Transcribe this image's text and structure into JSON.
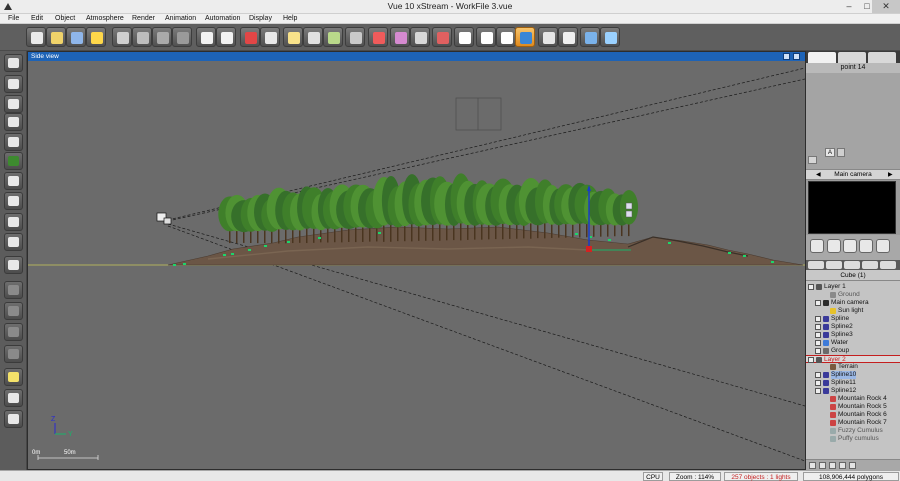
{
  "window": {
    "title": "Vue 10 xStream - WorkFile 3.vue",
    "minimize_label": "–",
    "maximize_label": "□",
    "close_label": "✕"
  },
  "menu": {
    "items": [
      "File",
      "Edit",
      "Object",
      "Atmosphere",
      "Render",
      "Animation",
      "Automation",
      "Display",
      "Help"
    ]
  },
  "toolbar": {
    "icons": [
      "new-file-icon",
      "open-file-icon",
      "save-file-icon",
      "quick-render-icon",
      "cut-icon",
      "copy-icon",
      "paste-icon",
      "duplicate-icon",
      "undo-icon",
      "redo-icon",
      "render-icon",
      "render-area-icon",
      "weather-icon",
      "object-editor-icon",
      "materials-icon",
      "group-icon",
      "color-palette-icon",
      "brush-icon",
      "stats-icon",
      "timeline-icon",
      "magic-icon",
      "zoom-fit-icon",
      "zoom-in-icon",
      "zoom-out-icon",
      "pan-icon",
      "animation-icon",
      "film-icon",
      "layout-icon",
      "world-browser-icon"
    ],
    "active_icon": "pan-icon"
  },
  "left_tools": {
    "icons": [
      "plane-icon",
      "sphere-icon",
      "text-icon",
      "terrain-icon",
      "mountain-icon",
      "plant-icon",
      "rock-icon",
      "cloud-icon",
      "light-icon",
      "spline-icon",
      "cube-icon",
      "boolean-icon",
      "metablob-icon",
      "group-object-icon",
      "ecosystem-icon",
      "sun-icon",
      "wind-icon",
      "external-icon"
    ]
  },
  "viewport": {
    "title": "Side view",
    "axis_z": "Z",
    "axis_y": "Y",
    "scale_start": "0m",
    "scale_end": "50m"
  },
  "right_panel": {
    "point_label": "point 14",
    "a_label": "A",
    "camera_title": "Main camera",
    "object_title": "Cube (1)",
    "tree": [
      {
        "label": "Layer 1",
        "depth": 0,
        "kind": "layer",
        "icon": "layer-icon"
      },
      {
        "label": "Ground",
        "depth": 2,
        "kind": "dim",
        "icon": "ground-icon"
      },
      {
        "label": "Main camera",
        "depth": 1,
        "kind": "item",
        "icon": "camera-icon"
      },
      {
        "label": "Sun light",
        "depth": 2,
        "kind": "item",
        "icon": "sun-icon"
      },
      {
        "label": "Spline",
        "depth": 1,
        "kind": "item",
        "icon": "spline-icon"
      },
      {
        "label": "Spline2",
        "depth": 1,
        "kind": "item",
        "icon": "spline-icon"
      },
      {
        "label": "Spline3",
        "depth": 1,
        "kind": "item",
        "icon": "spline-icon"
      },
      {
        "label": "Water",
        "depth": 1,
        "kind": "item",
        "icon": "water-icon"
      },
      {
        "label": "Group",
        "depth": 1,
        "kind": "item",
        "icon": "group-icon"
      },
      {
        "label": "Layer 2",
        "depth": 0,
        "kind": "layer2",
        "icon": "layer-icon"
      },
      {
        "label": "Terrain",
        "depth": 2,
        "kind": "item",
        "icon": "terrain-icon"
      },
      {
        "label": "Spline10",
        "depth": 1,
        "kind": "sel",
        "icon": "spline-icon"
      },
      {
        "label": "Spline11",
        "depth": 1,
        "kind": "item",
        "icon": "spline-icon"
      },
      {
        "label": "Spline12",
        "depth": 1,
        "kind": "item",
        "icon": "spline-icon"
      },
      {
        "label": "Mountain Rock 4",
        "depth": 2,
        "kind": "item",
        "icon": "rock-icon"
      },
      {
        "label": "Mountain Rock 5",
        "depth": 2,
        "kind": "item",
        "icon": "rock-icon"
      },
      {
        "label": "Mountain Rock 6",
        "depth": 2,
        "kind": "item",
        "icon": "rock-icon"
      },
      {
        "label": "Mountain Rock 7",
        "depth": 2,
        "kind": "item",
        "icon": "rock-icon"
      },
      {
        "label": "Fuzzy Cumulus",
        "depth": 2,
        "kind": "dim",
        "icon": "cloud-icon"
      },
      {
        "label": "Puffy cumulus",
        "depth": 2,
        "kind": "dim",
        "icon": "cloud-icon"
      }
    ]
  },
  "status": {
    "cpu": "CPU",
    "zoom": "Zoom : 114%",
    "objects": "257 objects : 1 lights",
    "polygons": "108,906,444 polygons"
  },
  "colors": {
    "viewport_header": "#1d63b7",
    "active_tool": "#f0a030",
    "selection": "#9bb8e6",
    "layer2_outline": "#c41e1e"
  }
}
